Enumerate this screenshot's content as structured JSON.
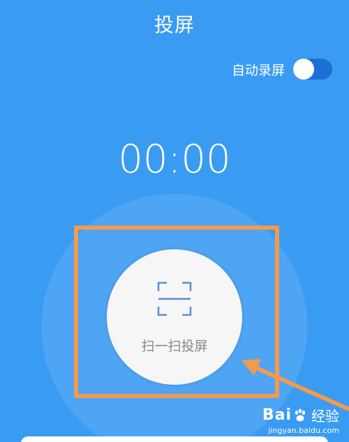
{
  "header": {
    "title": "投屏"
  },
  "auto_record": {
    "label": "自动录屏",
    "enabled": false
  },
  "timer": {
    "value": "00:00"
  },
  "scan_button": {
    "label": "扫一扫投屏",
    "icon": "scan-frame-icon"
  },
  "colors": {
    "background": "#3a9bf2",
    "toggle_track": "#1d6fd6",
    "highlight": "#f29a4e",
    "button_face": "#f6f6f6",
    "icon_stroke": "#5a8fd0"
  },
  "watermark": {
    "brand_left": "Bai",
    "brand_right": "经验",
    "url": "jingyan.baidu.com"
  }
}
